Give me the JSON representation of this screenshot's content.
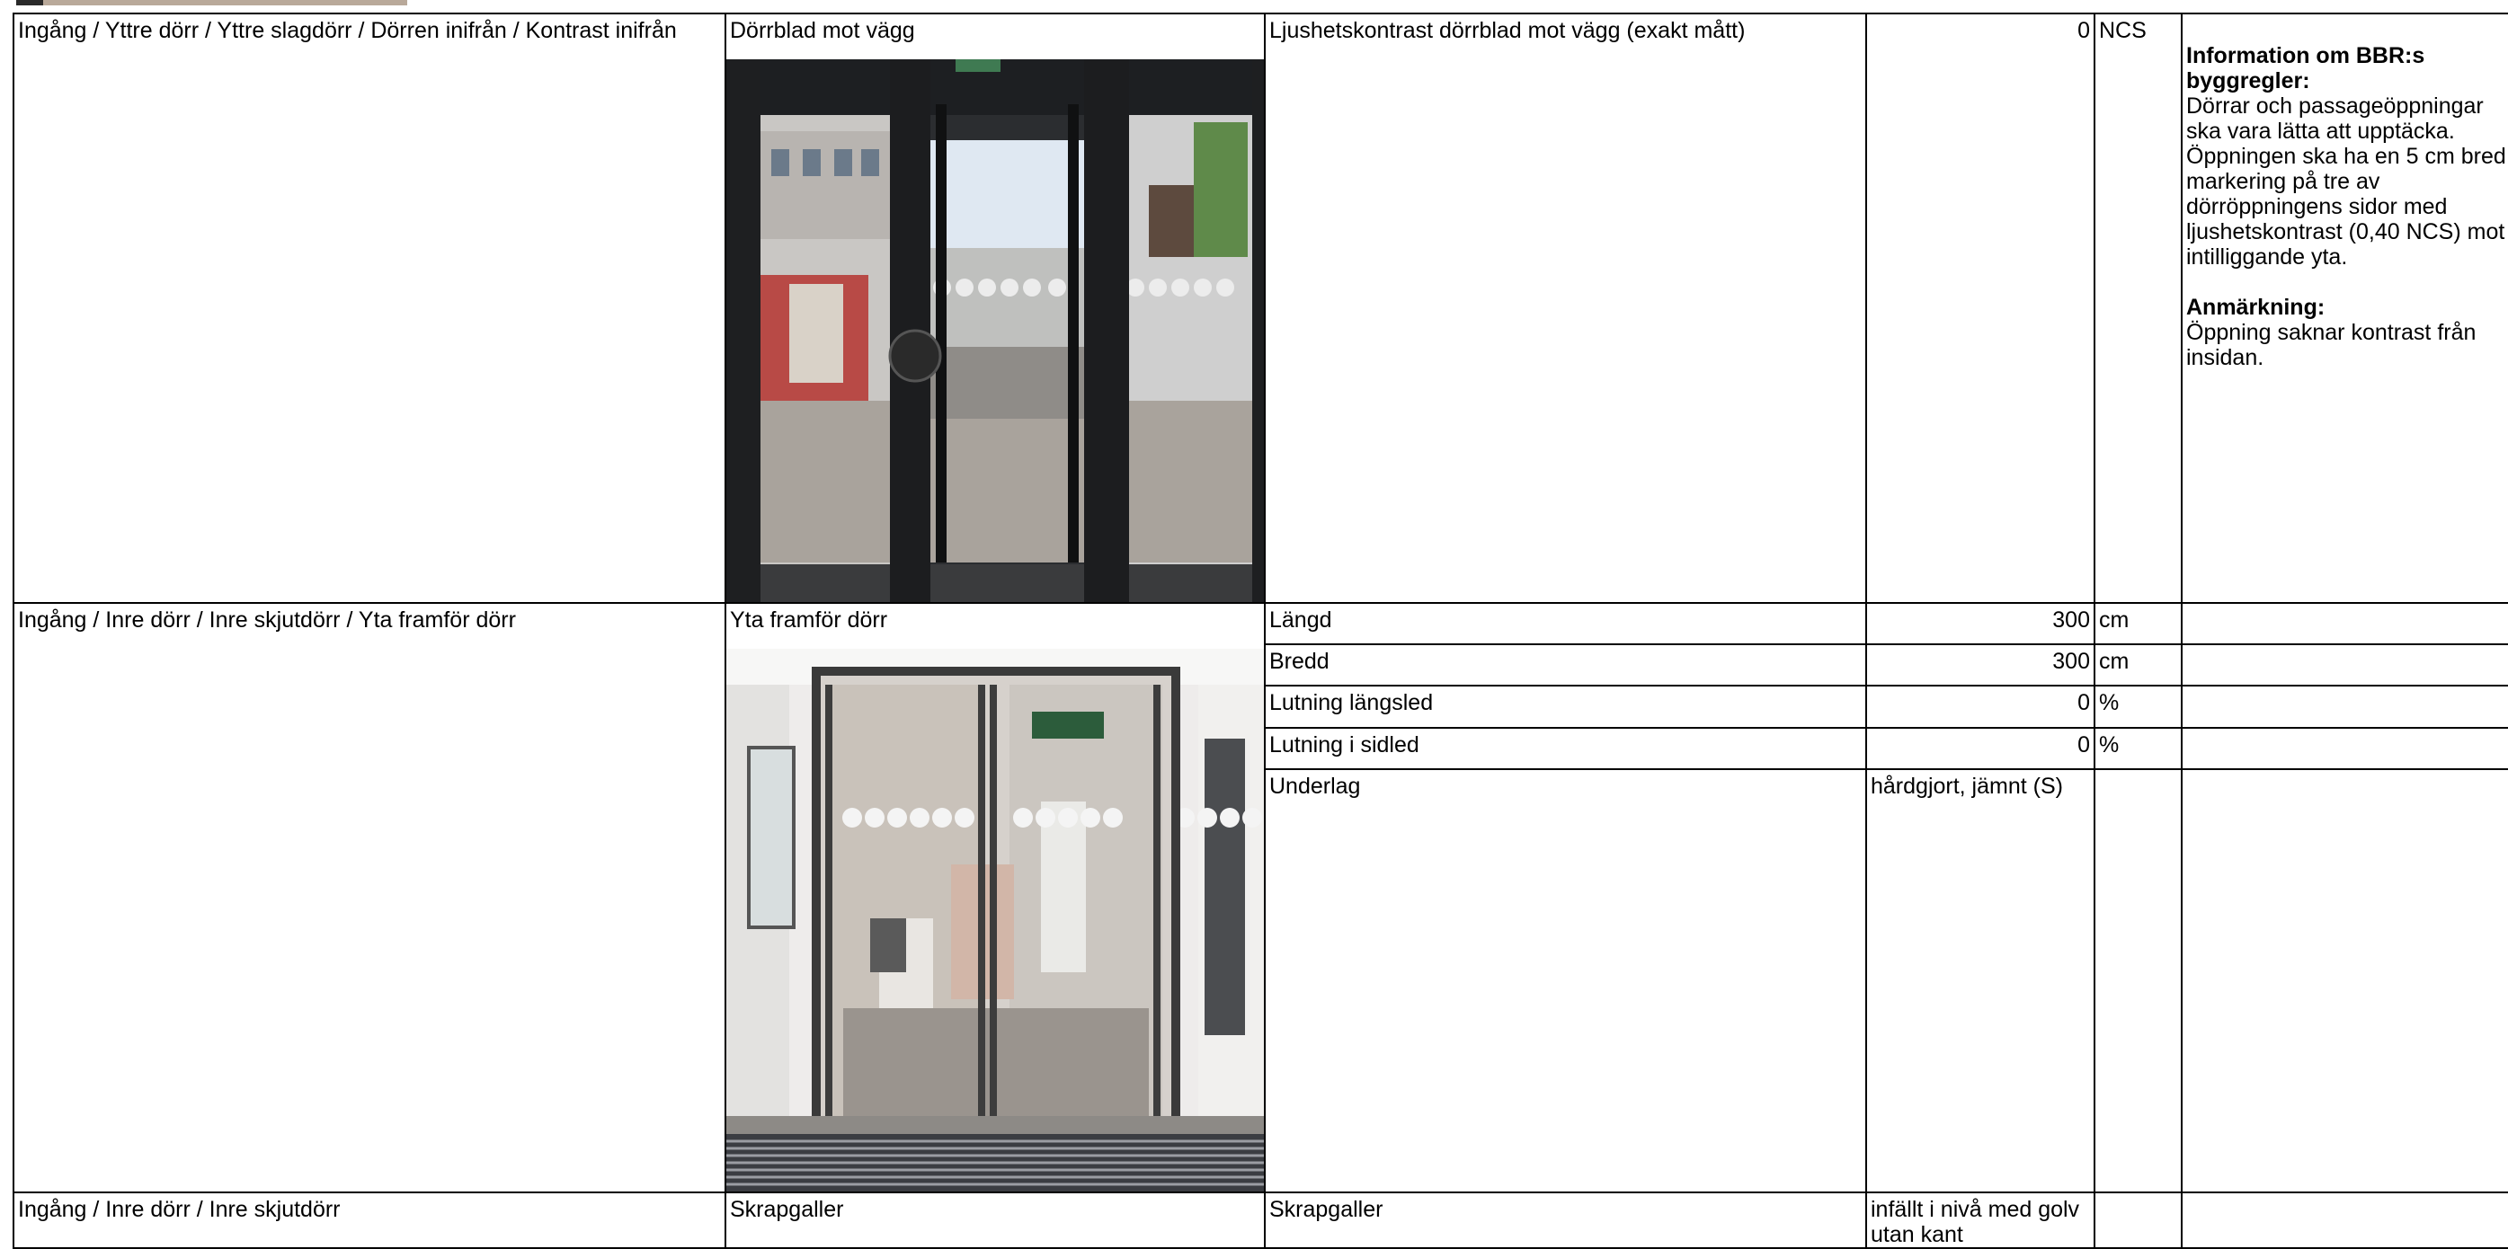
{
  "rows": [
    {
      "path": "Ingång / Yttre dörr / Yttre slagdörr  / Dörren inifrån / Kontrast inifrån",
      "photo_label": "Dörrblad mot vägg",
      "measurements": [
        {
          "label": "Ljushetskontrast dörrblad mot vägg (exakt mått)",
          "value": "0",
          "unit": "NCS"
        }
      ],
      "info": {
        "title": "Information om BBR:s byggregler:",
        "text": "Dörrar och passageöppningar ska vara lätta att upptäcka. Öppningen ska ha en 5 cm bred markering på tre av dörröppningens sidor med ljushetskontrast (0,40 NCS) mot intilliggande yta.",
        "note_title": "Anmärkning:",
        "note_text": "Öppning saknar kontrast från insidan."
      }
    },
    {
      "path": "Ingång / Inre dörr / Inre skjutdörr  / Yta framför dörr",
      "photo_label": "Yta framför dörr",
      "measurements": [
        {
          "label": "Längd",
          "value": "300",
          "unit": "cm"
        },
        {
          "label": "Bredd",
          "value": "300",
          "unit": "cm"
        },
        {
          "label": "Lutning längsled",
          "value": "0",
          "unit": "%"
        },
        {
          "label": "Lutning i sidled",
          "value": "0",
          "unit": "%"
        },
        {
          "label": "Underlag",
          "value": "hårdgjort, jämnt (S)",
          "unit": ""
        }
      ]
    },
    {
      "path": "Ingång / Inre dörr / Inre skjutdörr",
      "photo_label": "Skrapgaller",
      "measurements": [
        {
          "label": "Skrapgaller",
          "value": "infällt i nivå med golv utan kant",
          "unit": ""
        }
      ]
    }
  ]
}
